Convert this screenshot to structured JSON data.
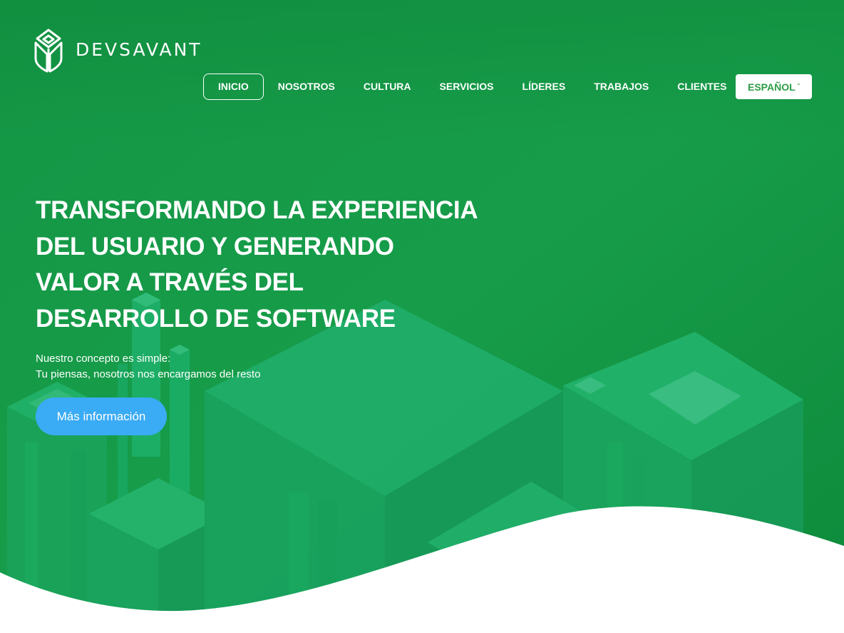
{
  "brand": {
    "name": "DEVSAVANT",
    "logo_icon": "leaf-shield-icon"
  },
  "nav": {
    "items": [
      {
        "label": "INICIO",
        "active": true
      },
      {
        "label": "NOSOTROS"
      },
      {
        "label": "CULTURA"
      },
      {
        "label": "SERVICIOS"
      },
      {
        "label": "LÍDERES"
      },
      {
        "label": "TRABAJOS"
      },
      {
        "label": "CLIENTES"
      }
    ],
    "language": {
      "label": "ESPAÑOL",
      "caret": "ˇ"
    }
  },
  "hero": {
    "title": "TRANSFORMANDO LA EXPERIENCIA DEL USUARIO Y GENERANDO VALOR A TRAVÉS DEL DESARROLLO DE SOFTWARE",
    "subtitle_line1": "Nuestro concepto es simple:",
    "subtitle_line2": "Tu piensas, nosotros nos encargamos del resto",
    "cta_label": "Más información"
  },
  "colors": {
    "hero_green": "#169a47",
    "hero_green_dark": "#0d8a3c",
    "cta_blue": "#3aabf5",
    "lang_text": "#2e9e45"
  }
}
